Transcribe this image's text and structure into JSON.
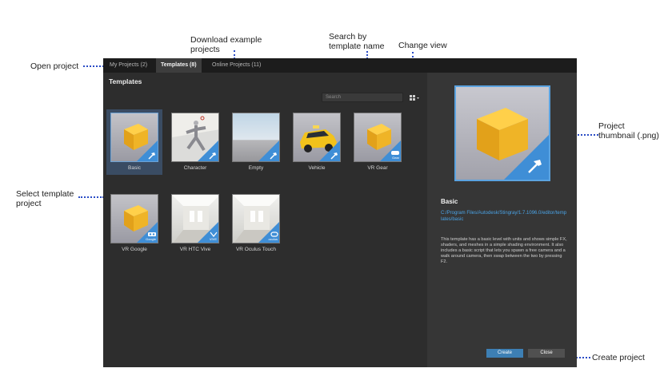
{
  "tabs": [
    {
      "label": "My Projects (2)"
    },
    {
      "label": "Templates (8)"
    },
    {
      "label": "Online Projects (11)"
    }
  ],
  "heading": "Templates",
  "search": {
    "placeholder": "Search"
  },
  "templates": [
    {
      "label": "Basic"
    },
    {
      "label": "Character"
    },
    {
      "label": "Empty"
    },
    {
      "label": "Vehicle"
    },
    {
      "label": "VR Gear"
    },
    {
      "label": "VR Google"
    },
    {
      "label": "VR HTC Vive"
    },
    {
      "label": "VR Oculus Touch"
    }
  ],
  "badges": {
    "gear": "Gear",
    "google": "Google",
    "vive": "VIVE",
    "oculus": "oculus"
  },
  "details": {
    "title": "Basic",
    "path": "C:/Program Files/Autodesk/Stingray/1.7.1096.0/editor/templates/basic",
    "description": "This template has a basic level with units and shows simple FX, shaders, and meshes in a simple shading environment. It also includes a basic script that lets you spawn a free camera and a walk around camera, then swap between the two by pressing F2.",
    "create_label": "Create",
    "close_label": "Close"
  },
  "callouts": {
    "open_project": "Open project",
    "download_line1": "Download example",
    "download_line2": "projects",
    "search_line1": "Search by",
    "search_line2": "template name",
    "change_view": "Change view",
    "thumbnail_line1": "Project",
    "thumbnail_line2": "thumbnail (.png)",
    "select_line1": "Select template",
    "select_line2": "project",
    "create_project": "Create project"
  },
  "colors": {
    "accent": "#3f8ed6",
    "selection": "#3a4c63",
    "create_button": "#3d7fb4",
    "callout_line": "#2a4cc6"
  },
  "icons": [
    "hammer-icon",
    "grid-view-icon",
    "chevron-down-icon"
  ]
}
